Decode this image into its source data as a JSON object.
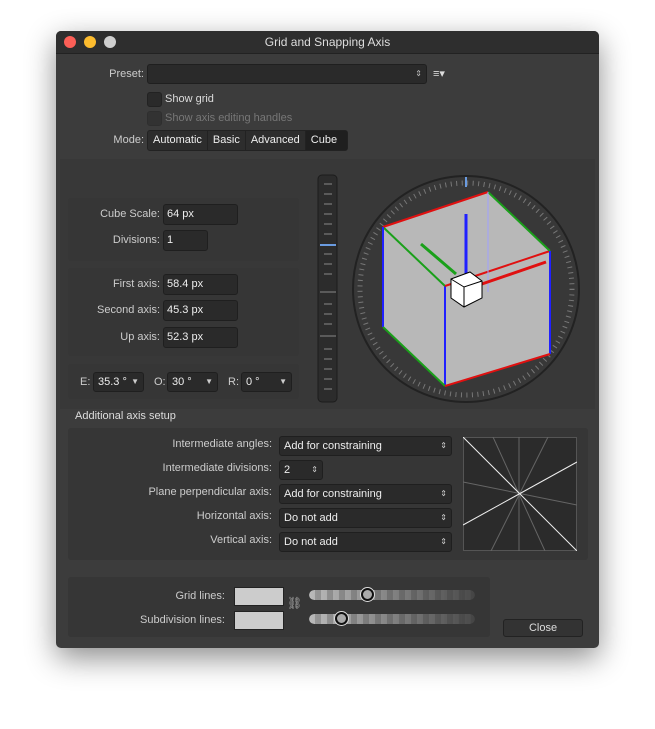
{
  "window": {
    "title": "Grid and Snapping Axis"
  },
  "preset": {
    "label": "Preset:",
    "value": ""
  },
  "show_grid": {
    "label": "Show grid",
    "checked": false
  },
  "show_axis_handles": {
    "label": "Show axis editing handles",
    "checked": false,
    "disabled": true
  },
  "mode": {
    "label": "Mode:",
    "options": [
      "Automatic",
      "Basic",
      "Advanced",
      "Cube"
    ],
    "selected": "Cube"
  },
  "cube": {
    "scale_label": "Cube Scale:",
    "scale": "64 px",
    "divisions_label": "Divisions:",
    "divisions": "1"
  },
  "axes": {
    "first_label": "First axis:",
    "first": "58.4 px",
    "second_label": "Second axis:",
    "second": "45.3 px",
    "up_label": "Up axis:",
    "up": "52.3 px"
  },
  "angles": {
    "e_label": "E:",
    "e": "35.3 °",
    "o_label": "O:",
    "o": "30 °",
    "r_label": "R:",
    "r": "0 °"
  },
  "additional": {
    "heading": "Additional axis setup",
    "rows": [
      {
        "label": "Intermediate angles:",
        "value": "Add for constraining"
      },
      {
        "label": "Intermediate divisions:",
        "value": "2"
      },
      {
        "label": "Plane perpendicular axis:",
        "value": "Add for constraining"
      },
      {
        "label": "Horizontal axis:",
        "value": "Do not add"
      },
      {
        "label": "Vertical axis:",
        "value": "Do not add"
      }
    ]
  },
  "lines": {
    "grid_label": "Grid lines:",
    "grid_opacity": 0.35,
    "subdivision_label": "Subdivision lines:",
    "subdivision_opacity": 0.19,
    "swatch_color": "#cccccc"
  },
  "close_label": "Close"
}
